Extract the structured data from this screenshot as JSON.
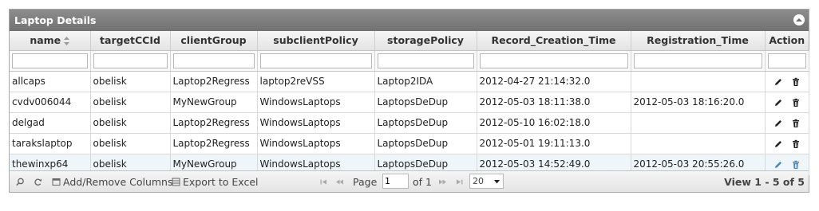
{
  "grid": {
    "title": "Laptop Details",
    "columns": [
      "name",
      "targetCCId",
      "clientGroup",
      "subclientPolicy",
      "storagePolicy",
      "Record_Creation_Time",
      "Registration_Time",
      "Action"
    ],
    "rows": [
      {
        "name": "allcaps",
        "targetCCId": "obelisk",
        "clientGroup": "Laptop2Regress",
        "subclientPolicy": "laptop2reVSS",
        "storagePolicy": "Laptop2IDA",
        "created": "2012-04-27 21:14:32.0",
        "registered": ""
      },
      {
        "name": "cvdv006044",
        "targetCCId": "obelisk",
        "clientGroup": "MyNewGroup",
        "subclientPolicy": "WindowsLaptops",
        "storagePolicy": "LaptopsDeDup",
        "created": "2012-05-03 18:11:38.0",
        "registered": "2012-05-03 18:16:20.0"
      },
      {
        "name": "delgad",
        "targetCCId": "obelisk",
        "clientGroup": "Laptop2Regress",
        "subclientPolicy": "WindowsLaptops",
        "storagePolicy": "LaptopsDeDup",
        "created": "2012-05-10 16:02:18.0",
        "registered": ""
      },
      {
        "name": "tarakslaptop",
        "targetCCId": "obelisk",
        "clientGroup": "Laptop2Regress",
        "subclientPolicy": "WindowsLaptops",
        "storagePolicy": "LaptopsDeDup",
        "created": "2012-05-01 19:11:13.0",
        "registered": ""
      },
      {
        "name": "thewinxp64",
        "targetCCId": "obelisk",
        "clientGroup": "MyNewGroup",
        "subclientPolicy": "WindowsLaptops",
        "storagePolicy": "LaptopsDeDup",
        "created": "2012-05-03 14:52:49.0",
        "registered": "2012-05-03 20:55:26.0"
      }
    ]
  },
  "pager": {
    "add_remove_columns": "Add/Remove Columns",
    "export_to_excel": "Export to Excel",
    "page_label": "Page",
    "page_value": "1",
    "of_label": "of 1",
    "rows_per_page": "20",
    "view_info": "View 1 - 5 of 5"
  },
  "colors": {
    "titlebar": "#808080",
    "selected_row": "#eef6fa",
    "edit_icon_selected": "#4a86b8"
  }
}
